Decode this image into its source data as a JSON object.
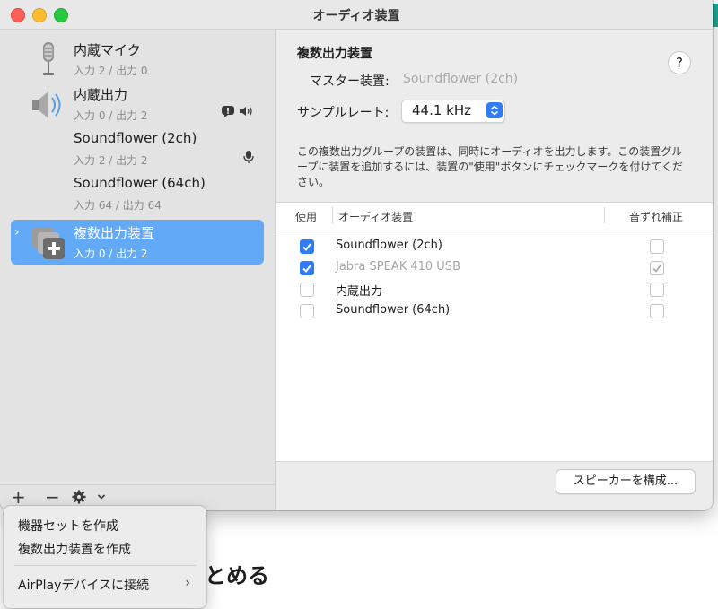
{
  "window": {
    "title": "オーディオ装置"
  },
  "sidebar": {
    "devices": [
      {
        "name": "内蔵マイク",
        "io": "入力 2 / 出力 0",
        "icon": "microphone-icon",
        "selected": false
      },
      {
        "name": "内蔵出力",
        "io": "入力 0 / 出力 2",
        "icon": "speaker-icon",
        "selected": false
      },
      {
        "name": "Soundflower (2ch)",
        "io": "入力 2 / 出力 2",
        "icon": "",
        "selected": false
      },
      {
        "name": "Soundflower (64ch)",
        "io": "入力 64 / 出力 64",
        "icon": "",
        "selected": false
      },
      {
        "name": "複数出力装置",
        "io": "入力 0 / 出力 2",
        "icon": "multi-output-icon",
        "selected": true
      }
    ],
    "footer": {
      "add": "+",
      "remove": "−"
    }
  },
  "main": {
    "title": "複数出力装置",
    "master_label": "マスター装置:",
    "master_value": "Soundflower (2ch)",
    "rate_label": "サンプルレート:",
    "rate_value": "44.1 kHz",
    "help": "?",
    "description": "この複数出力グループの装置は、同時にオーディオを出力します。この装置グループに装置を追加するには、装置の\"使用\"ボタンにチェックマークを付けてください。",
    "table": {
      "headers": {
        "use": "使用",
        "device": "オーディオ装置",
        "drift": "音ずれ補正"
      },
      "rows": [
        {
          "name": "Soundflower (2ch)",
          "use": true,
          "drift": false,
          "dimmed": false
        },
        {
          "name": "Jabra SPEAK 410 USB",
          "use": true,
          "drift": true,
          "dimmed": true
        },
        {
          "name": "内蔵出力",
          "use": false,
          "drift": false,
          "dimmed": false
        },
        {
          "name": "Soundflower (64ch)",
          "use": false,
          "drift": false,
          "dimmed": false
        }
      ]
    },
    "configure_speakers": "スピーカーを構成..."
  },
  "menu": {
    "items": [
      "機器セットを作成",
      "複数出力装置を作成",
      "AirPlayデバイスに接続"
    ]
  },
  "background": {
    "partial_text": "とめる"
  },
  "colors": {
    "accent": "#2f7cf6",
    "selection": "#62a9f8"
  }
}
